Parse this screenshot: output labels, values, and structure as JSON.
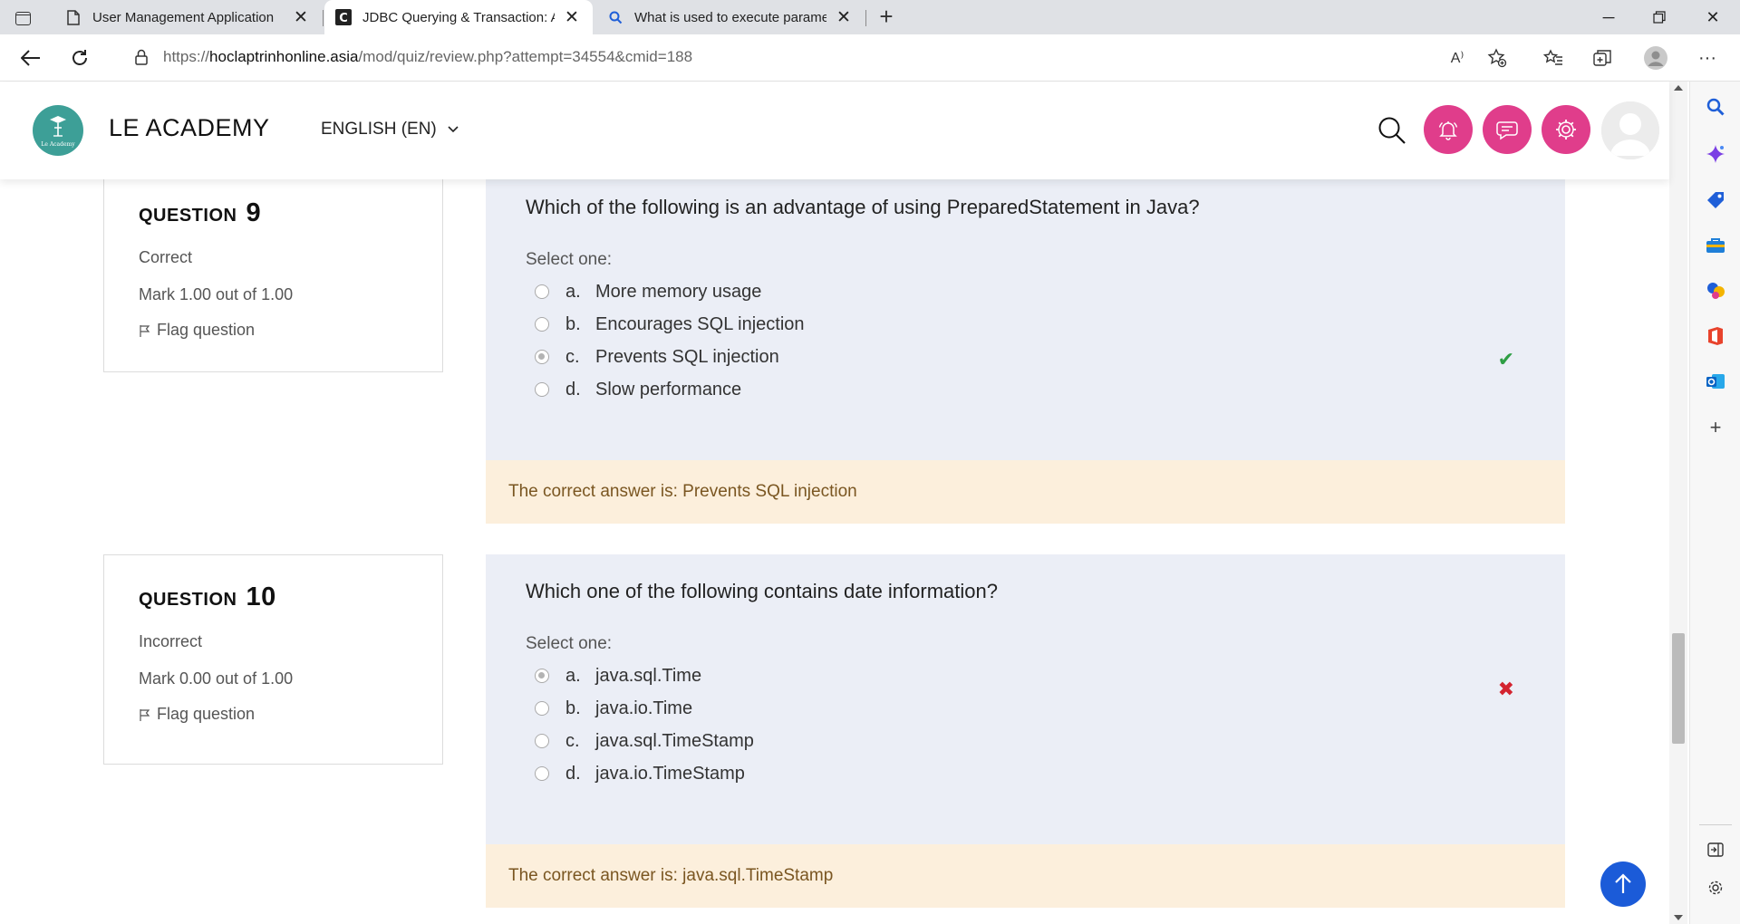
{
  "browser": {
    "tabs": [
      {
        "label": "User Management Application",
        "active": false
      },
      {
        "label": "JDBC Querying & Transaction: At",
        "active": true
      },
      {
        "label": "What is used to execute paramet",
        "active": false
      }
    ],
    "url": {
      "prefix": "https://",
      "host": "hoclaptrinhonline.asia",
      "path": "/mod/quiz/review.php?attempt=34554&cmid=188"
    },
    "read_aloud_label": "A⁾"
  },
  "site": {
    "brand": "LE ACADEMY",
    "logo_caption": "Le Academy",
    "language": "ENGLISH (EN)",
    "accent_color": "#e03d8b"
  },
  "questions": [
    {
      "label_word": "QUESTION",
      "number": "9",
      "state": "Correct",
      "mark": "Mark 1.00 out of 1.00",
      "flag": "Flag question",
      "text": "Which of the following is an advantage of using PreparedStatement in Java?",
      "prompt": "Select one:",
      "answers": [
        {
          "letter": "a.",
          "text": "More memory usage"
        },
        {
          "letter": "b.",
          "text": "Encourages SQL injection"
        },
        {
          "letter": "c.",
          "text": "Prevents SQL injection"
        },
        {
          "letter": "d.",
          "text": "Slow performance"
        }
      ],
      "mark_icon": "✔",
      "feedback": "The correct answer is: Prevents SQL injection"
    },
    {
      "label_word": "QUESTION",
      "number": "10",
      "state": "Incorrect",
      "mark": "Mark 0.00 out of 1.00",
      "flag": "Flag question",
      "text": "Which one of the following contains date information?",
      "prompt": "Select one:",
      "answers": [
        {
          "letter": "a.",
          "text": "java.sql.Time"
        },
        {
          "letter": "b.",
          "text": "java.io.Time"
        },
        {
          "letter": "c.",
          "text": "java.sql.TimeStamp"
        },
        {
          "letter": "d.",
          "text": "java.io.TimeStamp"
        }
      ],
      "mark_icon": "✖",
      "feedback": "The correct answer is: java.sql.TimeStamp"
    }
  ]
}
